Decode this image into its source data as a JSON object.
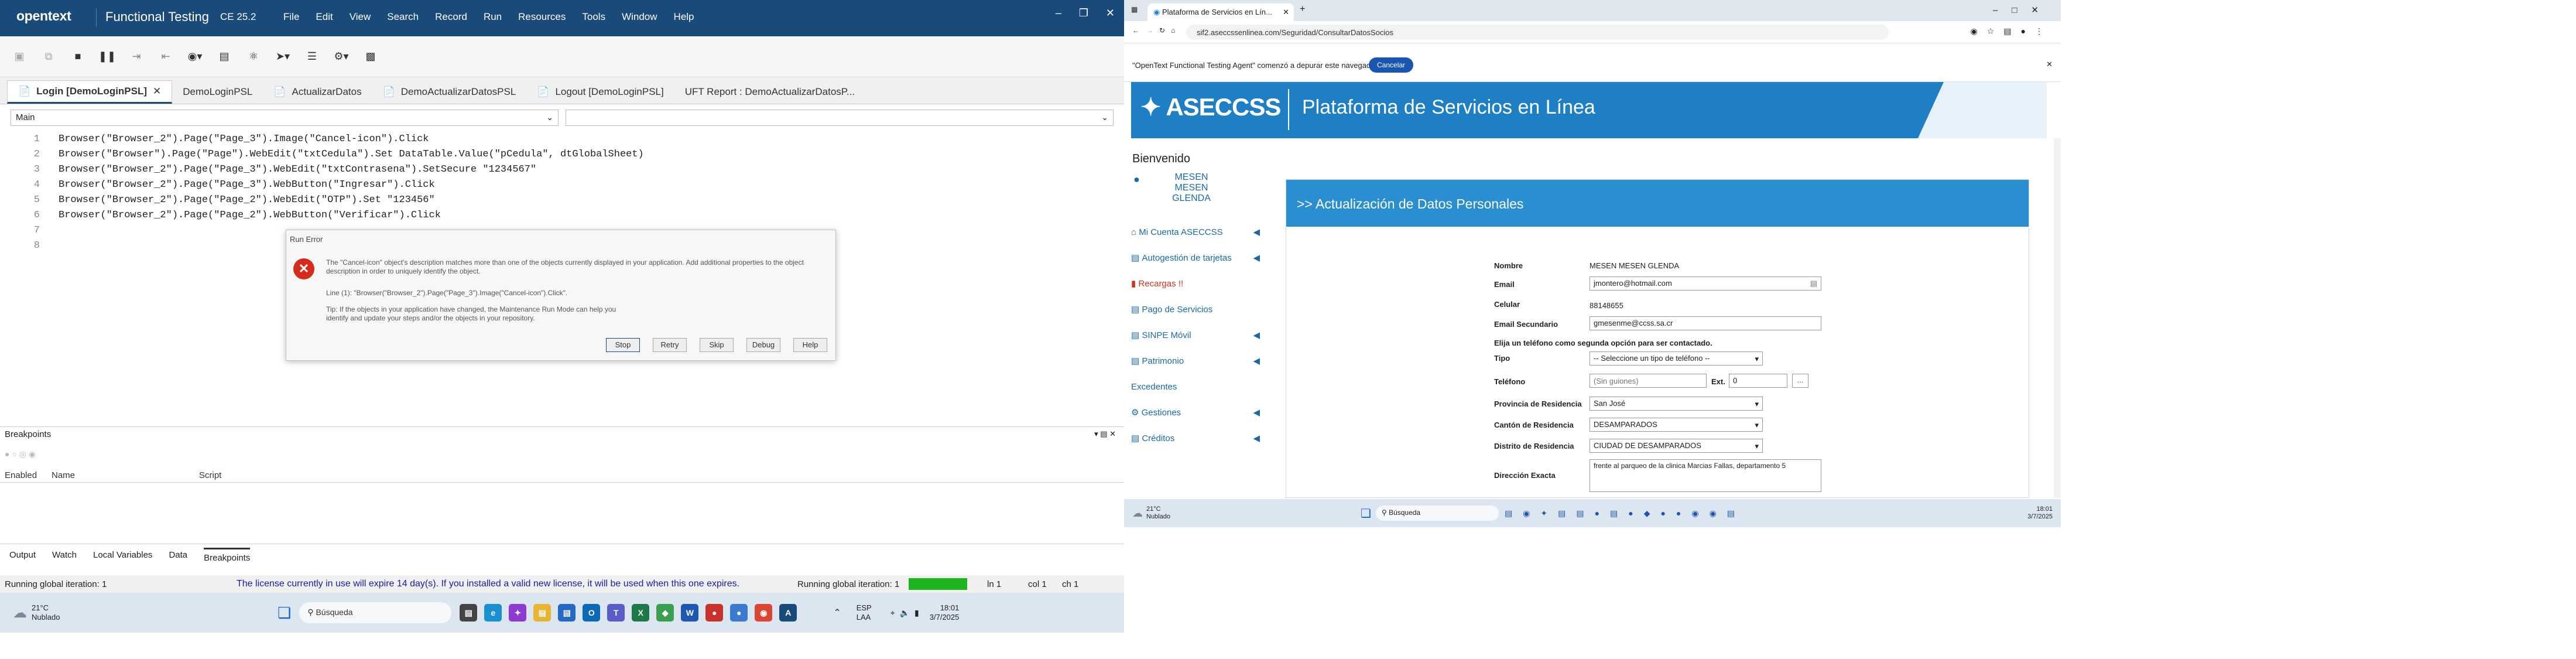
{
  "uft": {
    "logo": "opentext",
    "app_name": "Functional Testing",
    "version": "CE 25.2",
    "menu": [
      "File",
      "Edit",
      "View",
      "Search",
      "Record",
      "Run",
      "Resources",
      "Tools",
      "Window",
      "Help"
    ],
    "doc_tabs": [
      "Login [DemoLoginPSL]",
      "DemoLoginPSL",
      "ActualizarDatos",
      "DemoActualizarDatosPSL",
      "Logout [DemoLoginPSL]",
      "UFT Report : DemoActualizarDatosP..."
    ],
    "selector": "Main",
    "code_lines": [
      {
        "n": "1",
        "text": "Browser(\"Browser_2\").Page(\"Page_3\").Image(\"Cancel-icon\").Click"
      },
      {
        "n": "2",
        "text": "Browser(\"Browser\").Page(\"Page\").WebEdit(\"txtCedula\").Set DataTable.Value(\"pCedula\", dtGlobalSheet)"
      },
      {
        "n": "3",
        "text": "Browser(\"Browser_2\").Page(\"Page_3\").WebEdit(\"txtContrasena\").SetSecure \"1234567\""
      },
      {
        "n": "4",
        "text": "Browser(\"Browser_2\").Page(\"Page_3\").WebButton(\"Ingresar\").Click"
      },
      {
        "n": "5",
        "text": "Browser(\"Browser_2\").Page(\"Page_2\").WebEdit(\"OTP\").Set \"123456\""
      },
      {
        "n": "6",
        "text": "Browser(\"Browser_2\").Page(\"Page_2\").WebButton(\"Verificar\").Click"
      },
      {
        "n": "7",
        "text": ""
      },
      {
        "n": "8",
        "text": ""
      }
    ],
    "dialog": {
      "title": "Run Error",
      "message": "The \"Cancel-icon\" object's description matches more than one of the objects currently displayed in your application. Add additional properties to the object description in order to uniquely identify the object.",
      "line": "Line (1): \"Browser(\"Browser_2\").Page(\"Page_3\").Image(\"Cancel-icon\").Click\".",
      "tip": "Tip: If the objects in your application have changed, the Maintenance Run Mode can help you identify and update your steps and/or the objects in your repository.",
      "buttons": [
        "Stop",
        "Retry",
        "Skip",
        "Debug",
        "Help"
      ]
    },
    "breakpoints": {
      "title": "Breakpoints",
      "columns": [
        "Enabled",
        "Name",
        "Script"
      ]
    },
    "bottom_tabs": [
      "Output",
      "Watch",
      "Local Variables",
      "Data",
      "Breakpoints"
    ],
    "status": {
      "left": "Running global iteration: 1",
      "license": "The license currently in use will expire 14 day(s). If you installed a valid new license, it will be used when this one expires.",
      "iteration": "Running global iteration: 1",
      "ln": "ln 1",
      "col": "col 1",
      "ch": "ch 1"
    },
    "taskbar": {
      "temp": "21°C",
      "weather": "Nublado",
      "search": "Búsqueda",
      "lang1": "ESP",
      "lang2": "LAA",
      "time": "18:01",
      "date": "3/7/2025"
    }
  },
  "browser": {
    "tab_title": "Plataforma de Servicios en Lín...",
    "url": "sif2.aseccssenlinea.com/Seguridad/ConsultarDatosSocios",
    "infobar": "\"OpenText Functional Testing Agent\" comenzó a depurar este navegador",
    "cancel": "Cancelar",
    "logo": "ASECCSS",
    "hero_title": "Plataforma de Servicios en Línea",
    "welcome": "Bienvenido",
    "user_name": "MESEN MESEN GLENDA",
    "sidebar": [
      "Mi Cuenta ASECCSS",
      "Autogestión de tarjetas",
      "Recargas !!",
      "Pago de Servicios",
      "SINPE Móvil",
      "Patrimonio",
      "Excedentes",
      "Gestiones",
      "Créditos"
    ],
    "panel_title": ">> Actualización de Datos Personales",
    "fields": {
      "nombre_label": "Nombre",
      "nombre_value": "MESEN MESEN GLENDA",
      "email_label": "Email",
      "email_value": "jmontero@hotmail.com",
      "celular_label": "Celular",
      "celular_value": "88148655",
      "email2_label": "Email Secundario",
      "email2_value": "gmesenme@ccss.sa.cr",
      "phone_choice": "Elija un teléfono como segunda opción para ser contactado.",
      "tipo_label": "Tipo",
      "tipo_value": "-- Seleccione un tipo de teléfono --",
      "tel_label": "Teléfono",
      "tel_placeholder": "(Sin guiones)",
      "ext_label": "Ext.",
      "ext_value": "0",
      "prov_label": "Provincia de Residencia",
      "prov_value": "San José",
      "canton_label": "Cantón de Residencia",
      "canton_value": "DESAMPARADOS",
      "distrito_label": "Distrito de Residencia",
      "distrito_value": "CIUDAD DE DESAMPARADOS",
      "dir_label": "Dirección Exacta",
      "dir_value": "frente al parqueo de la clinica Marcias Fallas, departamento 5"
    },
    "taskbar": {
      "temp": "21°C",
      "weather": "Nublado",
      "search": "Búsqueda",
      "time": "18:01",
      "date": "3/7/2025"
    }
  },
  "colors": {
    "uft_titlebar": "#1a4a7a",
    "aseccss_blue": "#1e7fc4",
    "panel_header": "#2a8fd0",
    "license_text": "#1a1aa6",
    "progress_green": "#1db51d",
    "error_red": "#d52b1e"
  }
}
